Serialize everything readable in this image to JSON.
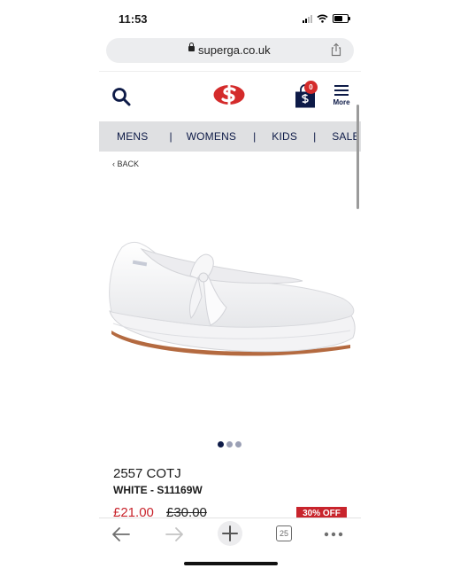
{
  "status_bar": {
    "time": "11:53",
    "battery_level": 0.7,
    "icons": [
      "signal-icon",
      "wifi-icon",
      "battery-icon"
    ]
  },
  "browser": {
    "url": "superga.co.uk",
    "tab_count": "25",
    "icons": [
      "lock-icon",
      "share-icon",
      "back-arrow-icon",
      "forward-arrow-icon",
      "new-tab-icon",
      "tabs-icon",
      "more-icon"
    ]
  },
  "header": {
    "cart_count": "0",
    "more_label": "More",
    "icons": [
      "search-icon",
      "superga-logo",
      "shopping-bag-icon",
      "hamburger-icon"
    ]
  },
  "nav": {
    "items": [
      "MENS",
      "WOMENS",
      "KIDS",
      "SALE"
    ],
    "separator": "|"
  },
  "back_label": "BACK",
  "product": {
    "name": "2557 COTJ",
    "color": "WHITE - S11169W",
    "price": "£21.00",
    "old_price": "£30.00",
    "discount": "30% OFF",
    "image_count": 3,
    "active_image": 0
  },
  "colors": {
    "brand_navy": "#0d1a47",
    "brand_red": "#c8242c",
    "nav_bg": "#dfe0e2"
  }
}
